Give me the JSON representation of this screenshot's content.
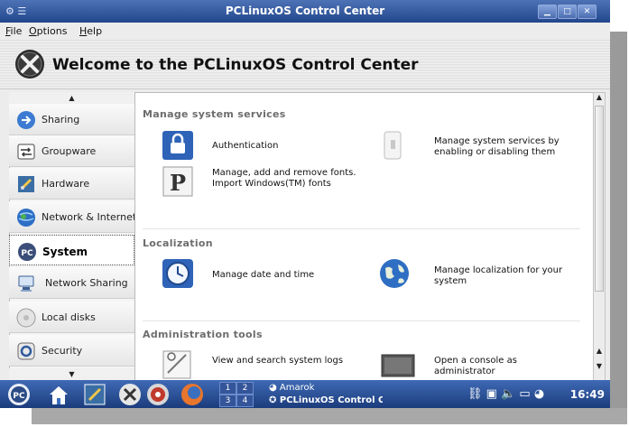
{
  "window": {
    "title": "PCLinuxOS Control Center"
  },
  "menubar": {
    "file": {
      "mnemonic": "F",
      "rest": "ile"
    },
    "options": {
      "mnemonic": "O",
      "rest": "ptions"
    },
    "help": {
      "mnemonic": "H",
      "rest": "elp"
    }
  },
  "header": {
    "title": "Welcome to the PCLinuxOS Control Center"
  },
  "sidebar": {
    "items": [
      {
        "label": "Sharing",
        "icon": "sharing-icon"
      },
      {
        "label": "Groupware",
        "icon": "groupware-icon"
      },
      {
        "label": "Hardware",
        "icon": "hardware-icon"
      },
      {
        "label": "Network & Internet",
        "icon": "network-icon"
      },
      {
        "label": "System",
        "icon": "system-icon",
        "selected": true
      },
      {
        "label": "Network Sharing",
        "icon": "network-sharing-icon"
      },
      {
        "label": "Local disks",
        "icon": "local-disks-icon"
      },
      {
        "label": "Security",
        "icon": "security-icon"
      }
    ]
  },
  "sections": {
    "manage": {
      "title": "Manage system services",
      "items": {
        "auth": "Authentication",
        "services": "Manage system services by enabling or disabling them",
        "fonts": "Manage, add and remove fonts. Import Windows(TM) fonts"
      }
    },
    "localization": {
      "title": "Localization",
      "items": {
        "datetime": "Manage date and time",
        "locale": "Manage localization for your system"
      }
    },
    "admin": {
      "title": "Administration tools",
      "items": {
        "logs": "View and search system logs",
        "console": "Open a console as administrator"
      }
    }
  },
  "taskbar": {
    "pager": [
      "1",
      "2",
      "3",
      "4"
    ],
    "tasks": [
      "Amarok",
      "PCLinuxOS Control Cen"
    ],
    "clock": "16:49"
  },
  "colors": {
    "titlebar": "#22468c",
    "taskbar": "#1b3c7c",
    "accent": "#3b6fc2"
  }
}
